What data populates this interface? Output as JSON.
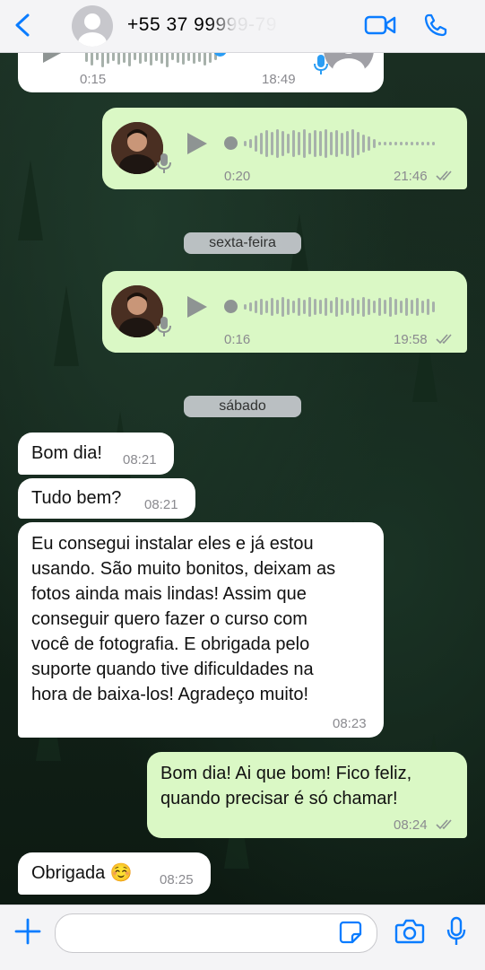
{
  "header": {
    "contact_name": "+55 37 99999-79",
    "back_icon": "chevron-left-icon",
    "video_icon": "video-camera-icon",
    "phone_icon": "phone-icon"
  },
  "messages": [
    {
      "type": "voice",
      "dir": "in",
      "duration": "0:15",
      "time": "18:49"
    },
    {
      "type": "voice",
      "dir": "out",
      "duration": "0:20",
      "time": "21:46"
    },
    {
      "type": "date",
      "label": "sexta-feira"
    },
    {
      "type": "voice",
      "dir": "out",
      "duration": "0:16",
      "time": "19:58"
    },
    {
      "type": "date",
      "label": "sábado"
    },
    {
      "type": "text",
      "dir": "in",
      "text": "Bom dia!",
      "time": "08:21"
    },
    {
      "type": "text",
      "dir": "in",
      "text": "Tudo bem?",
      "time": "08:21"
    },
    {
      "type": "text",
      "dir": "in",
      "lines": [
        "Eu consegui instalar eles e já estou",
        "usando. São muito bonitos, deixam as",
        "fotos ainda mais lindas! Assim que",
        "conseguir quero fazer o curso com",
        "você de fotografia. E obrigada pelo",
        "suporte quando tive dificuldades na",
        "hora de baixa-los! Agradeço muito!"
      ],
      "time": "08:23"
    },
    {
      "type": "text",
      "dir": "out",
      "lines": [
        "Bom dia! Ai que bom! Fico feliz,",
        "quando precisar é só chamar!"
      ],
      "time": "08:24"
    },
    {
      "type": "text",
      "dir": "in",
      "text": "Obrigada ☺️",
      "time": "08:25"
    }
  ],
  "input": {
    "placeholder": ""
  },
  "colors": {
    "accent": "#0a7cff",
    "outgoing": "#daf8c5",
    "incoming": "#ffffff"
  }
}
